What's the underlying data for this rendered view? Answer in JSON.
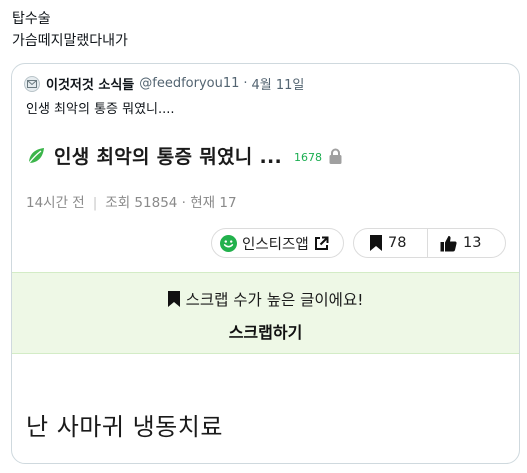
{
  "post": {
    "line1": "탑수술",
    "line2": "가슴떼지말랬다내가"
  },
  "quote": {
    "name": "이것저것 소식들",
    "handle": "@feedforyou11",
    "separator": "·",
    "date": "4월 11일",
    "text": "인생 최악의 통증 뭐였니....",
    "icon": "avatar-icon"
  },
  "inner_post": {
    "title": "인생 최악의 통증 뭐였니 ...",
    "count": "1678",
    "time": "14시간 전",
    "divider": "|",
    "views": "조회 51854",
    "dot": "·",
    "current": "현재 17",
    "leaf_color": "#3bb54a",
    "count_color": "#1cae52"
  },
  "actions": {
    "insti_label": "인스티즈앱",
    "scrap_count": "78",
    "like_count": "13",
    "icons": [
      "smile-icon",
      "external-link-icon",
      "bookmark-icon",
      "thumbs-up-icon"
    ]
  },
  "banner": {
    "line1": "스크랩 수가 높은 글이에요!",
    "cta": "스크랩하기",
    "background": "#eef8e6"
  },
  "body_text": "난 사마귀 냉동치료"
}
